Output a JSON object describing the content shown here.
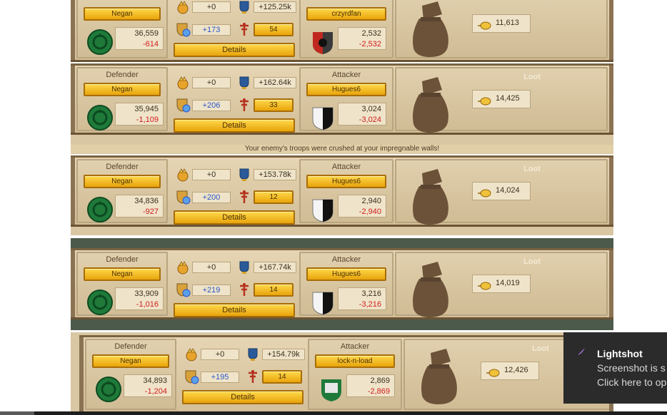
{
  "battles": [
    {
      "defender_title": "",
      "defender_name": "Negan",
      "defender_value": "36,559",
      "defender_loss": "-614",
      "crown_value": "+0",
      "cup_value": "+125.25k",
      "shield_value": "+173",
      "rank_value": "54",
      "details_label": "Details",
      "attacker_title": "",
      "attacker_name": "crzyrdfan",
      "attacker_value": "2,532",
      "attacker_loss": "-2,532",
      "loot_title": "",
      "loot_value": "11,613",
      "attacker_shield": "red"
    },
    {
      "defender_title": "Defender",
      "defender_name": "Negan",
      "defender_value": "35,945",
      "defender_loss": "-1,109",
      "crown_value": "+0",
      "cup_value": "+162.64k",
      "shield_value": "+206",
      "rank_value": "33",
      "details_label": "Details",
      "attacker_title": "Attacker",
      "attacker_name": "Hugues6",
      "attacker_value": "3,024",
      "attacker_loss": "-3,024",
      "loot_title": "Loot",
      "loot_value": "14,425",
      "attacker_shield": "bw"
    },
    {
      "defender_title": "Defender",
      "defender_name": "Negan",
      "defender_value": "34,836",
      "defender_loss": "-927",
      "crown_value": "+0",
      "cup_value": "+153.78k",
      "shield_value": "+200",
      "rank_value": "12",
      "details_label": "Details",
      "attacker_title": "Attacker",
      "attacker_name": "Hugues6",
      "attacker_value": "2,940",
      "attacker_loss": "-2,940",
      "loot_title": "Loot",
      "loot_value": "14,024",
      "attacker_shield": "bw"
    },
    {
      "defender_title": "Defender",
      "defender_name": "Negan",
      "defender_value": "33,909",
      "defender_loss": "-1,016",
      "crown_value": "+0",
      "cup_value": "+167.74k",
      "shield_value": "+219",
      "rank_value": "14",
      "details_label": "Details",
      "attacker_title": "Attacker",
      "attacker_name": "Hugues6",
      "attacker_value": "3,216",
      "attacker_loss": "-3,216",
      "loot_title": "Loot",
      "loot_value": "14,019",
      "attacker_shield": "bw"
    },
    {
      "defender_title": "Defender",
      "defender_name": "Negan",
      "defender_value": "34,893",
      "defender_loss": "-1,204",
      "crown_value": "+0",
      "cup_value": "+154.79k",
      "shield_value": "+195",
      "rank_value": "14",
      "details_label": "Details",
      "attacker_title": "Attacker",
      "attacker_name": "lock-n-load",
      "attacker_value": "2,869",
      "attacker_loss": "-2,869",
      "loot_title": "Loot",
      "loot_value": "12,426",
      "attacker_shield": "green"
    }
  ],
  "banner_text": "Your enemy's troops were crushed at your impregnable walls!",
  "toast": {
    "title": "Lightshot",
    "line1": "Screenshot is s",
    "line2": "Click here to op"
  },
  "colors": {
    "gold_button": "#f2c12e",
    "loss_red": "#d11c1c",
    "gain_blue": "#2c55c9",
    "shield_green": "#1f7a3a"
  }
}
